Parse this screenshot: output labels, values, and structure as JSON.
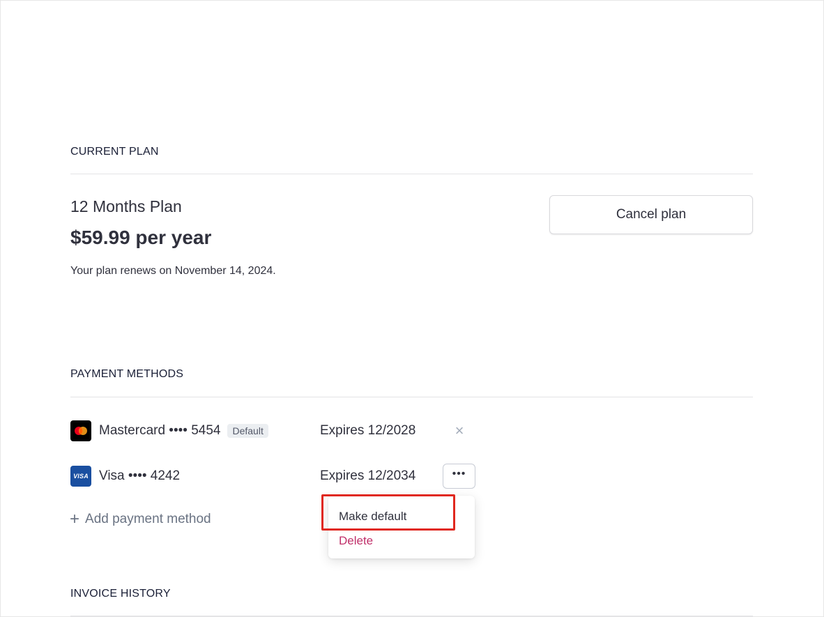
{
  "current_plan": {
    "heading": "CURRENT PLAN",
    "plan_name": "12 Months Plan",
    "price": "$59.99 per year",
    "renewal_text": "Your plan renews on November 14, 2024.",
    "cancel_label": "Cancel plan"
  },
  "payment_methods": {
    "heading": "PAYMENT METHODS",
    "cards": [
      {
        "brand_icon": "mastercard-icon",
        "label": "Mastercard •••• 5454",
        "badge": "Default",
        "expires": "Expires 12/2028",
        "action_icon": "close-icon"
      },
      {
        "brand_icon": "visa-icon",
        "logo_text": "VISA",
        "label": "Visa •••• 4242",
        "expires": "Expires 12/2034",
        "action_icon": "more-icon"
      }
    ],
    "more_label": "•••",
    "remove_label": "×",
    "add_icon": "plus-icon",
    "add_label": "Add payment method",
    "menu": {
      "items": [
        {
          "label": "Make default",
          "color": "#30313d"
        },
        {
          "label": "Delete",
          "color": "#c0306a"
        }
      ],
      "highlight_color": "#e0281e"
    }
  },
  "invoice_history": {
    "heading": "INVOICE HISTORY"
  }
}
